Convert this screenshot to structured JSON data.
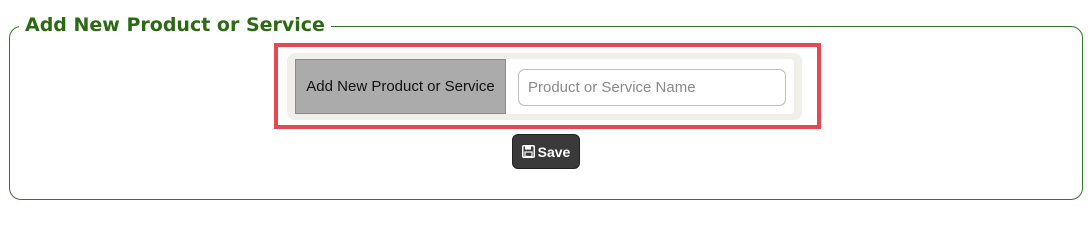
{
  "panel": {
    "legend": "Add New Product or Service"
  },
  "form": {
    "addon_label": "Add New Product or Service",
    "input_value": "",
    "input_placeholder": "Product or Service Name",
    "save_label": "Save",
    "save_icon": "floppy-disk-icon"
  },
  "colors": {
    "legend_green": "#2b6a12",
    "border_green": "#2e7d1f",
    "highlight_red": "#e9474f",
    "addon_gray": "#ababab",
    "button_dark": "#3a3a3a"
  }
}
